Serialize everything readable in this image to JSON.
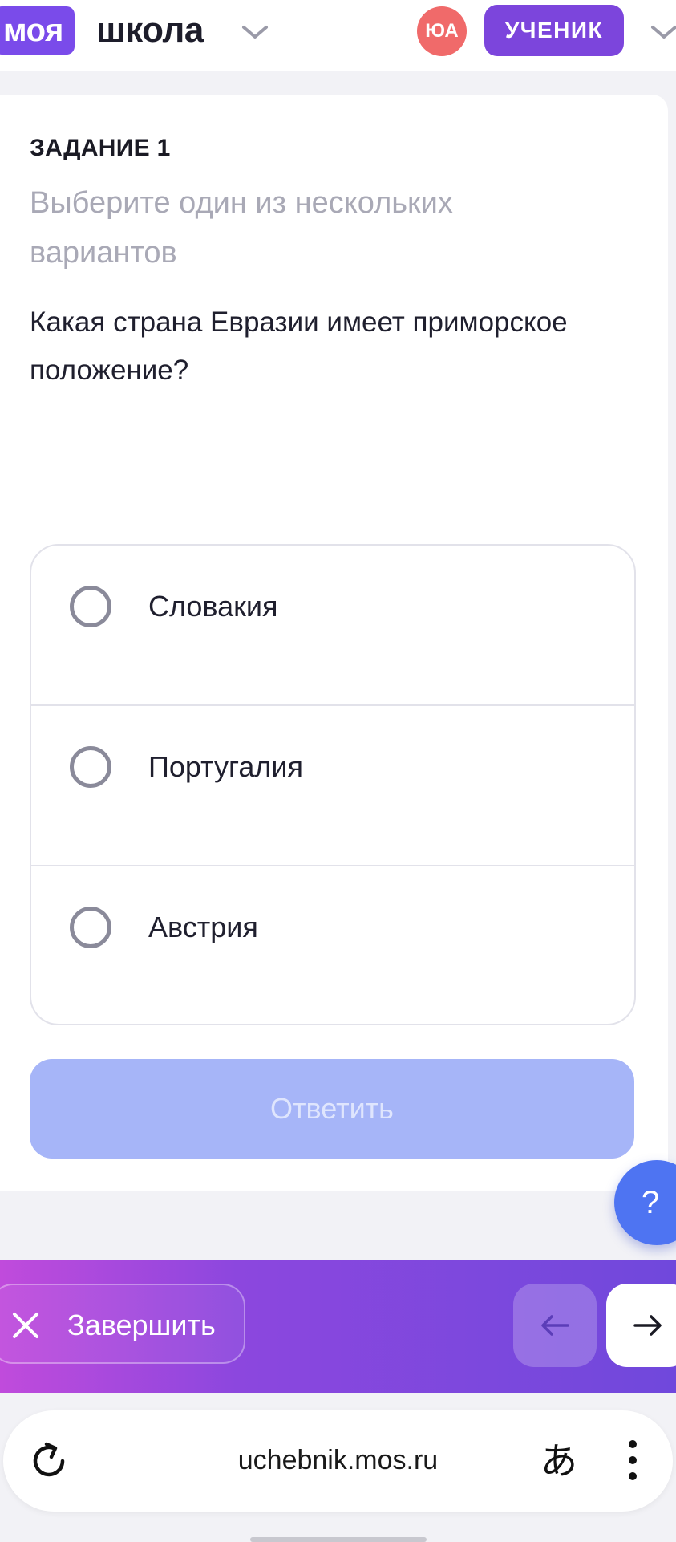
{
  "header": {
    "logo_part1": "моя",
    "logo_part2": "школа",
    "avatar_initials": "ЮА",
    "role_label": "УЧЕНИК"
  },
  "task": {
    "title": "ЗАДАНИЕ 1",
    "instruction": "Выберите один из нескольких вариантов",
    "question": "Какая страна Евразии имеет приморское положение?",
    "options": [
      {
        "label": "Словакия",
        "selected": false
      },
      {
        "label": "Португалия",
        "selected": false
      },
      {
        "label": "Австрия",
        "selected": false
      }
    ],
    "answer_label": "Ответить"
  },
  "help": {
    "label": "?"
  },
  "bottom_bar": {
    "finish_label": "Завершить"
  },
  "browser": {
    "url": "uchebnik.mos.ru",
    "translate_glyph": "あ"
  },
  "colors": {
    "brand_purple": "#7a4bea",
    "role_purple": "#7c45dc",
    "avatar_red": "#f06a6a",
    "answer_disabled": "#a6b5f8",
    "help_blue": "#4e74f2"
  }
}
